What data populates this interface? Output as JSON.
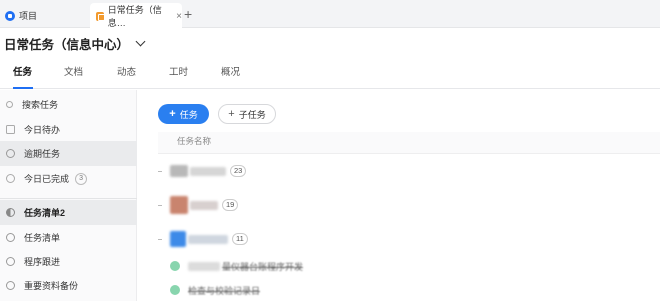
{
  "browser": {
    "tabs": [
      {
        "label": "项目",
        "icon": "project-icon"
      },
      {
        "label": "日常任务（信息…",
        "icon": "task-doc-icon",
        "close": "×"
      }
    ],
    "new_tab": "+"
  },
  "header": {
    "title": "日常任务（信息中心）"
  },
  "module_tabs": [
    "任务",
    "文档",
    "动态",
    "工时",
    "概况"
  ],
  "sidebar": {
    "items": [
      {
        "label": "搜索任务",
        "icon": "search-icon"
      },
      {
        "label": "今日待办",
        "icon": "calendar-icon"
      },
      {
        "label": "逾期任务",
        "icon": "clock-icon"
      },
      {
        "label": "今日已完成",
        "icon": "check-icon",
        "count": "3"
      },
      {
        "label": "任务清单2",
        "icon": "half-circle-icon"
      },
      {
        "label": "任务清单",
        "icon": "list-ring-icon"
      },
      {
        "label": "程序跟进",
        "icon": "list-ring-icon"
      },
      {
        "label": "重要资料备份",
        "icon": "list-ring-icon"
      }
    ]
  },
  "main": {
    "add_task_label": "任务",
    "add_subtask_label": "子任务",
    "column_header": "任务名称",
    "rows": [
      {
        "count": "23",
        "avatar_color": "#b8b8b8"
      },
      {
        "count": "19",
        "avatar_color": "#c9846e"
      },
      {
        "count": "11",
        "avatar_color": "#3d8ae8"
      }
    ],
    "subtasks": [
      {
        "text": "量仪器台账程序开发",
        "status_color": "#27b36b"
      },
      {
        "text": "检查与校验记录日",
        "status_color": "#27b36b"
      }
    ]
  },
  "colors": {
    "accent": "#2a7ff0",
    "done": "#27b36b",
    "tab_orange": "#f29a2e"
  }
}
